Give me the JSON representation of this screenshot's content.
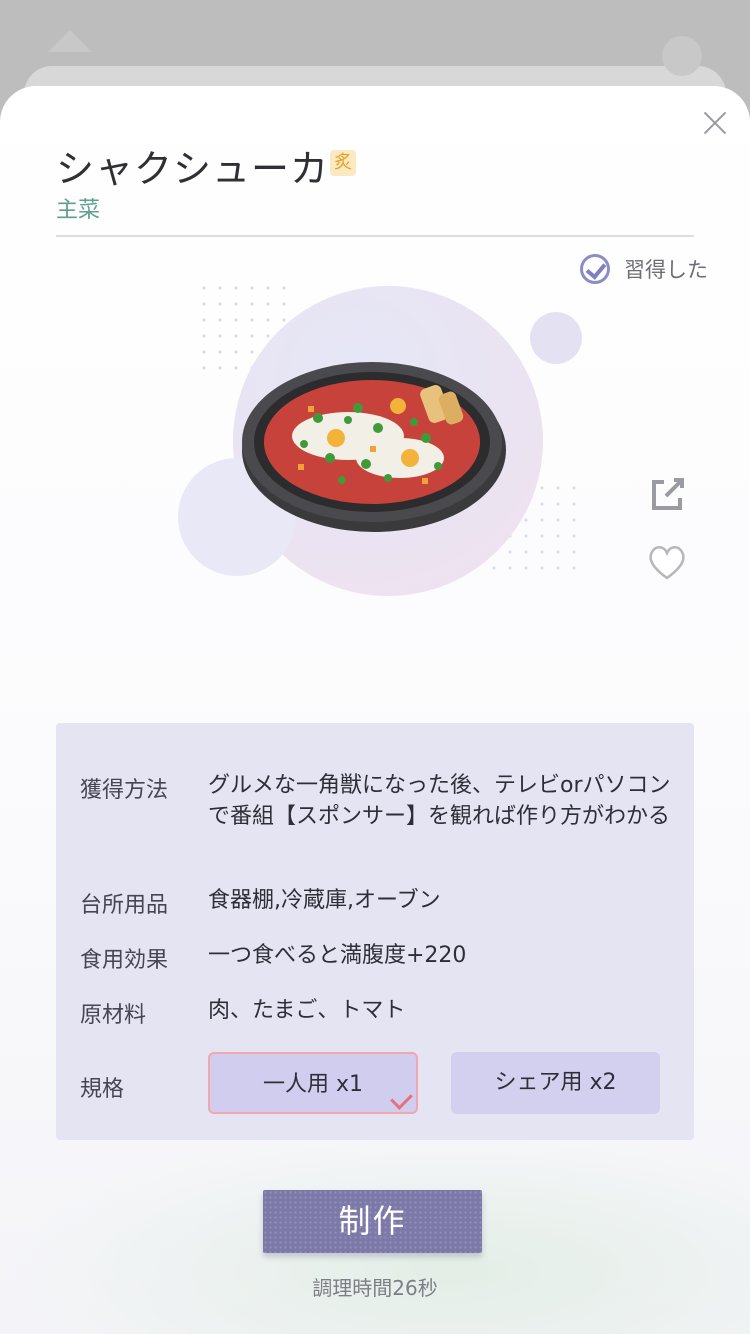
{
  "background": {
    "left_icon": "home-icon",
    "right_icon": "avatar-icon"
  },
  "header": {
    "title": "シャクシューカ",
    "badge_text": "炙",
    "category": "主菜",
    "close_icon": "close-icon"
  },
  "status": {
    "learned_label": "習得した",
    "icon": "check-circle-icon"
  },
  "actions": {
    "share_icon": "share-icon",
    "favorite_icon": "heart-icon"
  },
  "details": [
    {
      "label": "獲得方法",
      "value": "グルメな一角獣になった後、テレビorパソコンで番組【スポンサー】を観れば作り方がわかる"
    },
    {
      "label": "台所用品",
      "value": "食器棚,冷蔵庫,オーブン"
    },
    {
      "label": "食用効果",
      "value": "一つ食べると満腹度+220"
    },
    {
      "label": "原材料",
      "value": "肉、たまご、トマト"
    }
  ],
  "spec": {
    "label": "規格",
    "options": [
      {
        "label": "一人用 x1",
        "selected": true
      },
      {
        "label": "シェア用 x2",
        "selected": false
      }
    ]
  },
  "footer": {
    "make_label": "制作",
    "cook_time": "調理時間26秒"
  },
  "colors": {
    "accent": "#7c78a8",
    "category": "#5da08e",
    "panel": "#e5e4f2",
    "selected_border": "#f2a7ac"
  }
}
